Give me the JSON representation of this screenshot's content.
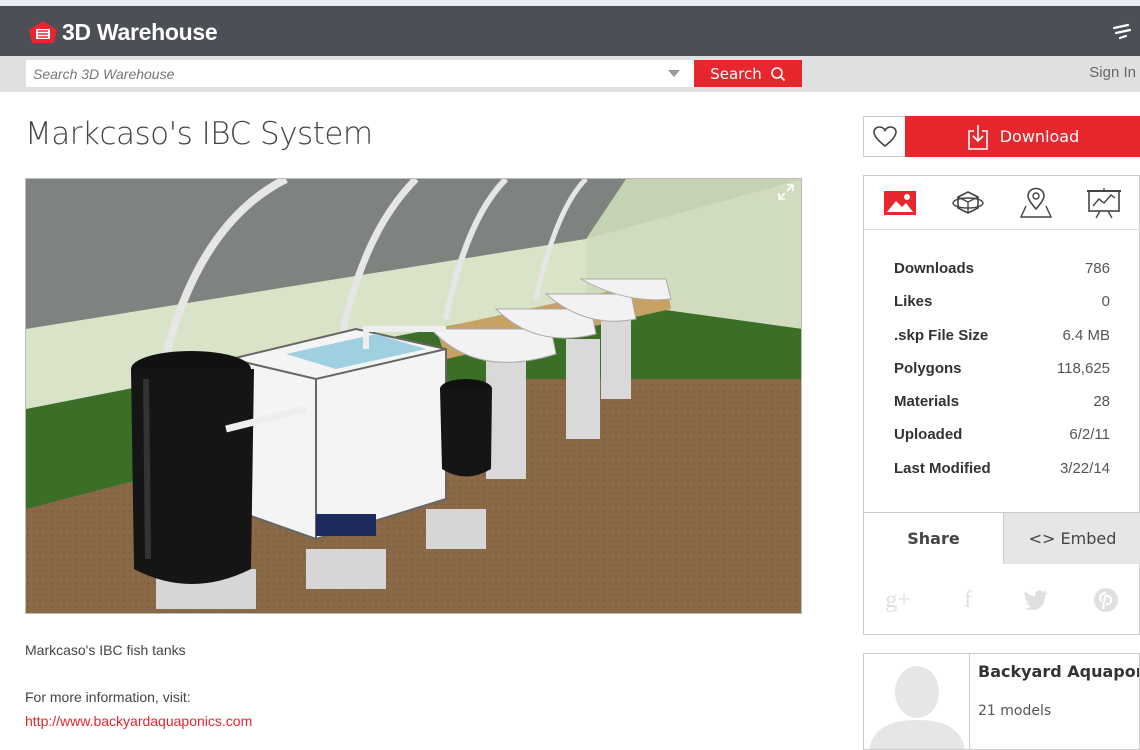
{
  "header": {
    "brand": "3D Warehouse",
    "brand_color": "#e8262d",
    "bar_color": "#4c4f55"
  },
  "search": {
    "placeholder": "Search 3D Warehouse",
    "button_label": "Search",
    "signin_label": "Sign In"
  },
  "model": {
    "title": "Markcaso's IBC System",
    "description": "Markcaso's IBC fish tanks",
    "more_info": "For more information, visit:",
    "link": "http://www.backyardaquaponics.com"
  },
  "actions": {
    "download_label": "Download"
  },
  "viewer_tabs": [
    "image-icon",
    "3d-rotate-icon",
    "location-icon",
    "presentation-icon"
  ],
  "stats": [
    {
      "label": "Downloads",
      "value": "786"
    },
    {
      "label": "Likes",
      "value": "0"
    },
    {
      "label": ".skp File Size",
      "value": "6.4 MB"
    },
    {
      "label": "Polygons",
      "value": "118,625"
    },
    {
      "label": "Materials",
      "value": "28"
    },
    {
      "label": "Uploaded",
      "value": "6/2/11"
    },
    {
      "label": "Last Modified",
      "value": "3/22/14"
    }
  ],
  "share": {
    "share_label": "Share",
    "embed_label": "<> Embed"
  },
  "author": {
    "name": "Backyard Aquapon...",
    "models": "21 models"
  }
}
